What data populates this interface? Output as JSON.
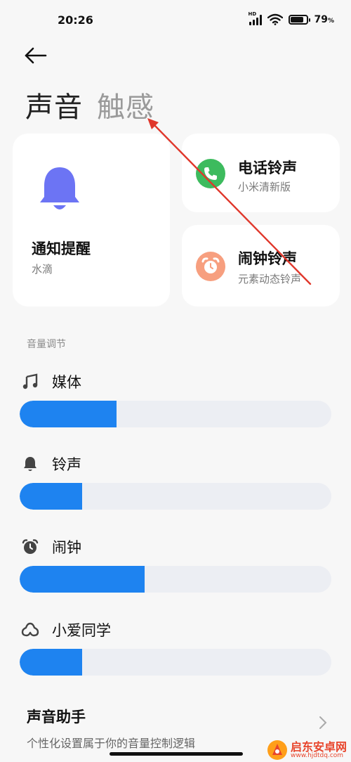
{
  "status_bar": {
    "time": "20:26",
    "battery": "79",
    "battery_unit": "%",
    "battery_level": 0.79,
    "network": "HD"
  },
  "tabs": [
    {
      "label": "声音",
      "active": true
    },
    {
      "label": "触感",
      "active": false
    }
  ],
  "cards": {
    "notification": {
      "title": "通知提醒",
      "subtitle": "水滴"
    },
    "phone": {
      "title": "电话铃声",
      "subtitle": "小米清新版"
    },
    "alarm": {
      "title": "闹钟铃声",
      "subtitle": "元素动态铃声"
    }
  },
  "volume": {
    "section_label": "音量调节",
    "items": [
      {
        "label": "媒体",
        "icon": "music-note-icon",
        "level": 0.31
      },
      {
        "label": "铃声",
        "icon": "bell-icon",
        "level": 0.2
      },
      {
        "label": "闹钟",
        "icon": "alarm-clock-icon",
        "level": 0.4
      },
      {
        "label": "小爱同学",
        "icon": "xiaoai-icon",
        "level": 0.2
      }
    ]
  },
  "assistant": {
    "title": "声音助手",
    "subtitle": "个性化设置属于你的音量控制逻辑"
  },
  "watermark": {
    "text": "启东安卓网",
    "url": "www.hjdtdq.com"
  },
  "colors": {
    "accent": "#1e83f0",
    "track": "#eceef3",
    "bell": "#6c74f4",
    "phone": "#3dbb5e",
    "alarm": "#f79f7f",
    "annotation": "#e0372b"
  }
}
